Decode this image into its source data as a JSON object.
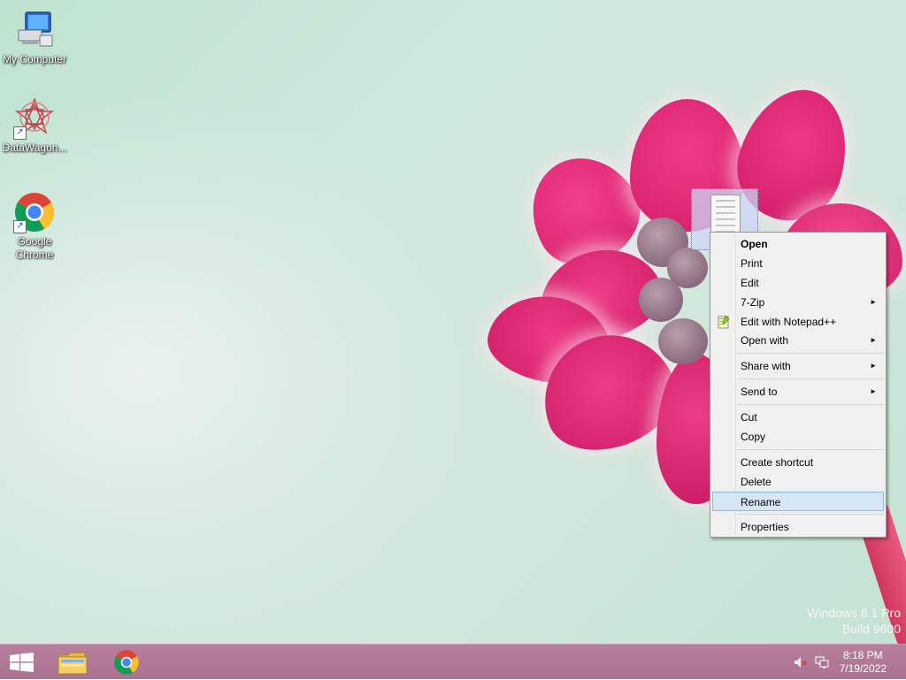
{
  "desktop": {
    "icons": [
      {
        "label": "My Computer",
        "icon": "my-computer-icon"
      },
      {
        "label": "DataWagon...",
        "icon": "datawagon-icon"
      },
      {
        "label": "Google Chrome",
        "icon": "chrome-icon"
      }
    ],
    "watermark": {
      "line1": "Windows 8.1 Pro",
      "line2": "Build 9600"
    }
  },
  "context_menu": {
    "items": [
      {
        "label": "Open",
        "bold": true
      },
      {
        "label": "Print"
      },
      {
        "label": "Edit"
      },
      {
        "label": "7-Zip",
        "submenu": true
      },
      {
        "label": "Edit with Notepad++",
        "icon": "notepad-plus-plus-icon"
      },
      {
        "label": "Open with",
        "submenu": true
      },
      {
        "label": "Share with",
        "submenu": true
      },
      {
        "label": "Send to",
        "submenu": true
      },
      {
        "label": "Cut"
      },
      {
        "label": "Copy"
      },
      {
        "label": "Create shortcut"
      },
      {
        "label": "Delete"
      },
      {
        "label": "Rename",
        "highlighted": true
      },
      {
        "label": "Properties"
      }
    ],
    "submenu_arrow": "►"
  },
  "taskbar": {
    "buttons": [
      {
        "name": "start",
        "icon": "windows-logo-icon"
      },
      {
        "name": "file-explorer",
        "icon": "folder-icon"
      },
      {
        "name": "chrome",
        "icon": "chrome-icon"
      }
    ],
    "clock": {
      "time": "8:18 PM",
      "date": "7/19/2022"
    }
  },
  "colors": {
    "taskbar": "#ab7392",
    "menu_highlight": "#d5e6f5",
    "menu_highlight_border": "#90b6dc"
  }
}
